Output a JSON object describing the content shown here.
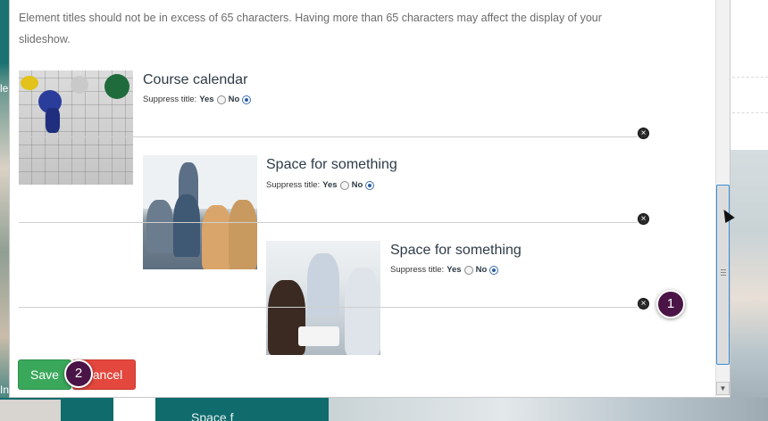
{
  "modal": {
    "intro_text": "Element titles should not be in excess of 65 characters. Having more than 65 characters may affect the display of your slideshow."
  },
  "items": [
    {
      "title": "Course calendar",
      "suppress_label": "Suppress title:",
      "yes_label": "Yes",
      "no_label": "No",
      "selected": "No",
      "image_icon": "calendar-with-pushpins-image"
    },
    {
      "title": "Space for something",
      "suppress_label": "Suppress title:",
      "yes_label": "Yes",
      "no_label": "No",
      "selected": "No",
      "image_icon": "classroom-lecture-image"
    },
    {
      "title": "Space for something",
      "suppress_label": "Suppress title:",
      "yes_label": "Yes",
      "no_label": "No",
      "selected": "No",
      "image_icon": "office-team-image"
    }
  ],
  "buttons": {
    "save_label": "Save",
    "cancel_label": "ancel"
  },
  "markers": {
    "marker_1": "1",
    "marker_2": "2"
  },
  "background": {
    "bottom_text": "Space f",
    "left_letter_1": "le",
    "left_letter_2": "In"
  },
  "colors": {
    "save": "#3aa85a",
    "cancel": "#e3473d",
    "marker": "#4a1446",
    "teal": "#0f6b6c"
  }
}
